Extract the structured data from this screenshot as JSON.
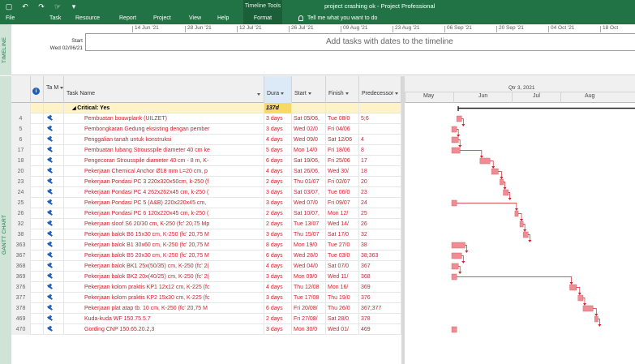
{
  "titlebar": {
    "tool_tab": "Timeline Tools",
    "doc_title": "project crashing ok  -  Project Professional"
  },
  "ribbon": {
    "tabs": [
      "File",
      "Task",
      "Resource",
      "Report",
      "Project",
      "View",
      "Help"
    ],
    "format_tab": "Format",
    "tell_me": "Tell me what you want to do"
  },
  "timeline": {
    "side_label": "TIMELINE",
    "start_label": "Start",
    "start_date": "Wed 02/06/21",
    "dates": [
      "14 Jun '21",
      "28 Jun '21",
      "12 Jul '21",
      "26 Jul '21",
      "09 Aug '21",
      "23 Aug '21",
      "06 Sep '21",
      "20 Sep '21",
      "04 Oct '21",
      "18 Oct"
    ],
    "placeholder": "Add tasks with dates to the timeline"
  },
  "gantt": {
    "side_label": "GANTT CHART",
    "columns": {
      "mode": "Ta M",
      "name": "Task Name",
      "duration": "Dura",
      "start": "Start",
      "finish": "Finish",
      "predecessors": "Predecessor"
    },
    "chart_header": {
      "quarter": "Qtr 3, 2021",
      "months": [
        "May",
        "Jun",
        "Jul",
        "Aug"
      ]
    },
    "summary": {
      "name": "Critical: Yes",
      "duration": "137d"
    },
    "rows": [
      {
        "id": "4",
        "name": "Pembuatan bouwplank (UILZET)",
        "duration": "3 days",
        "start": "Sat 05/06,",
        "finish": "Tue 08/0",
        "pred": "5;6"
      },
      {
        "id": "5",
        "name": "Pembongkaran Gedung eksisting dengan pember",
        "duration": "3 days",
        "start": "Wed 02/0",
        "finish": "Fri 04/06",
        "pred": ""
      },
      {
        "id": "6",
        "name": "Penggalian tanah untuk konstruksi",
        "duration": "4 days",
        "start": "Wed 09/0",
        "finish": "Sat 12/06",
        "pred": "4"
      },
      {
        "id": "17",
        "name": "Pembuatan lubang Strousspile diameter 40 cm ke",
        "duration": "5 days",
        "start": "Mon 14/0",
        "finish": "Fri 18/06",
        "pred": "8"
      },
      {
        "id": "18",
        "name": "Pengecoran Strousspile diameter 40 cm - 8 m, K-",
        "duration": "6 days",
        "start": "Sat 19/06,",
        "finish": "Fri 25/06",
        "pred": "17"
      },
      {
        "id": "20",
        "name": "Pekerjaan Chemical Anchor Ø18 mm L=20 cm, p",
        "duration": "4 days",
        "start": "Sat 26/06,",
        "finish": "Wed 30/",
        "pred": "18"
      },
      {
        "id": "23",
        "name": "Pekerjaan Pondasi PC 3 220x320x50cm, k-250 (f",
        "duration": "2 days",
        "start": "Thu 01/07",
        "finish": "Fri 02/07",
        "pred": "20"
      },
      {
        "id": "24",
        "name": "Pekerjaan Pondasi PC 4 262x262x45 cm, k-250 (",
        "duration": "3 days",
        "start": "Sat 03/07,",
        "finish": "Tue 06/0",
        "pred": "23"
      },
      {
        "id": "25",
        "name": "Pekerjaan Pondasi PC 5 (A&B) 220x220x45 cm,",
        "duration": "3 days",
        "start": "Wed 07/0",
        "finish": "Fri 09/07",
        "pred": "24"
      },
      {
        "id": "26",
        "name": "Pekerjaan Pondasi PC 6 120x220x45 cm, k-250 (",
        "duration": "2 days",
        "start": "Sat 10/07,",
        "finish": "Mon 12/",
        "pred": "25"
      },
      {
        "id": "32",
        "name": "Pekerjaan sloof S6 20/30 cm, K-250 (fc' 20,75 Mp",
        "duration": "2 days",
        "start": "Tue 13/07",
        "finish": "Wed 14/",
        "pred": "26"
      },
      {
        "id": "38",
        "name": "Pekerjaan balok B6 15x30 cm, K-250 (fc' 20,75 M",
        "duration": "3 days",
        "start": "Thu 15/07",
        "finish": "Sat 17/0",
        "pred": "32"
      },
      {
        "id": "363",
        "name": "Pekerjaan balok B1 30x60 cm, K-250 (fc' 20,75 M",
        "duration": "8 days",
        "start": "Mon 19/0",
        "finish": "Tue 27/0",
        "pred": "38"
      },
      {
        "id": "367",
        "name": "Pekerjaan balok B5 20x30 cm, K-250 (fc' 20,75 M",
        "duration": "6 days",
        "start": "Wed 28/0",
        "finish": "Tue 03/0",
        "pred": "38;363"
      },
      {
        "id": "368",
        "name": "Pekerjaan balok BK1 25x(50/35) cm, K-250 (fc' 2(",
        "duration": "4 days",
        "start": "Wed 04/0",
        "finish": "Sat 07/0",
        "pred": "367"
      },
      {
        "id": "369",
        "name": "Pekerjaan balok BK2 20x(40/25) cm, K-250 (fc' 2(",
        "duration": "3 days",
        "start": "Mon 09/0",
        "finish": "Wed 11/",
        "pred": "368"
      },
      {
        "id": "376",
        "name": "Pekerjaan kolom praktis KP1 12x12 cm, K-225 (fc",
        "duration": "4 days",
        "start": "Thu 12/08",
        "finish": "Mon 16/",
        "pred": "369"
      },
      {
        "id": "377",
        "name": "Pekerjaan kolom praktis KP2 15x30 cm, K-225 (fc",
        "duration": "3 days",
        "start": "Tue 17/08",
        "finish": "Thu 19/0",
        "pred": "376"
      },
      {
        "id": "378",
        "name": "Pekerjaan plat atap tb. 10 cm, K-250 (fc' 20,75 M",
        "duration": "6 days",
        "start": "Fri 20/08/",
        "finish": "Thu 26/0",
        "pred": "367;377"
      },
      {
        "id": "469",
        "name": "Kuda-kuda WF 150.75.5.7",
        "duration": "2 days",
        "start": "Fri 27/08/",
        "finish": "Sat 28/0",
        "pred": "378"
      },
      {
        "id": "470",
        "name": "Gording CNP 150.65.20.2,3",
        "duration": "3 days",
        "start": "Mon 30/0",
        "finish": "Wed 01/",
        "pred": "469"
      }
    ]
  },
  "colors": {
    "ribbon": "#217346",
    "critical_text": "#d01e2a",
    "bar_fill": "#f08c94",
    "summary_row": "#fdf3c7"
  }
}
